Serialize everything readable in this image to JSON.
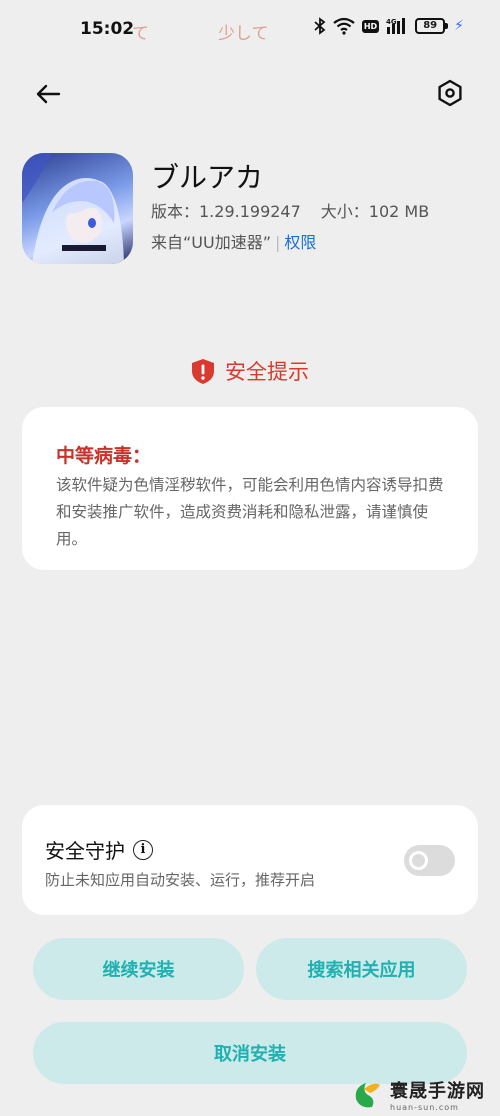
{
  "status_bar": {
    "time": "15:02",
    "notif_1": "て",
    "notif_2": "少して",
    "battery": "89"
  },
  "header": {
    "back_icon": "arrow-left-icon",
    "settings_icon": "hexagon-gear-icon"
  },
  "app": {
    "name": "ブルアカ",
    "version_label": "版本：1.29.199247",
    "size_label": "大小：102 MB",
    "source_label": "来自“UU加速器”",
    "permissions_link": "权限"
  },
  "security": {
    "title": "安全提示",
    "warning_title": "中等病毒：",
    "warning_body": "该软件疑为色情淫秽软件，可能会利用色情内容诱导扣费和安装推广软件，造成资费消耗和隐私泄露，请谨慎使用。"
  },
  "protection": {
    "title": "安全守护",
    "description": "防止未知应用自动安装、运行，推荐开启",
    "enabled": false
  },
  "buttons": {
    "continue": "继续安装",
    "search": "搜索相关应用",
    "cancel": "取消安装"
  },
  "watermark": {
    "main": "寰晟手游网",
    "sub": "huan-sun.com"
  },
  "colors": {
    "danger": "#d93a2f",
    "accent": "#1fb1b1",
    "link": "#1a6fd8"
  }
}
